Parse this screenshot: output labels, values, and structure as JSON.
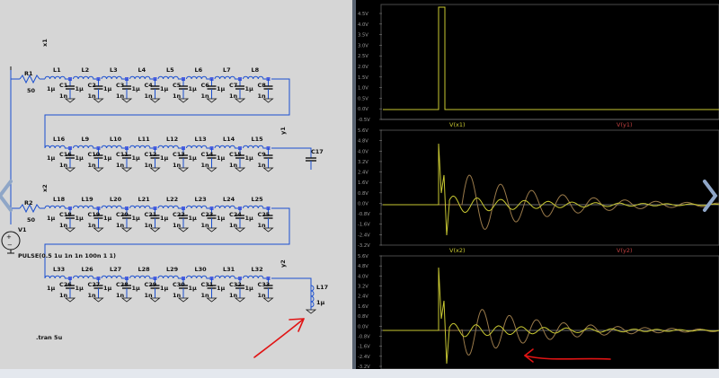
{
  "schematic": {
    "components": {
      "r1": "R1",
      "r1_val": "50",
      "r2": "R2",
      "r2_val": "50",
      "v1": "V1",
      "c17": "C17",
      "l17": "L17",
      "l17_val": "1µ"
    },
    "net_labels": {
      "x1": "x1",
      "y1": "y1",
      "x2": "x2",
      "y2": "y2"
    },
    "row1_inductors": [
      "L1",
      "L2",
      "L3",
      "L4",
      "L5",
      "L6",
      "L7",
      "L8"
    ],
    "row2_inductors": [
      "L16",
      "L9",
      "L10",
      "L11",
      "L12",
      "L13",
      "L14",
      "L15"
    ],
    "row3_inductors": [
      "L18",
      "L19",
      "L20",
      "L21",
      "L22",
      "L23",
      "L24",
      "L25"
    ],
    "row4_inductors": [
      "L33",
      "L26",
      "L27",
      "L28",
      "L29",
      "L30",
      "L31",
      "L32"
    ],
    "row1_caps": [
      "C1",
      "C2",
      "C3",
      "C4",
      "C5",
      "C6",
      "C7",
      "C8"
    ],
    "row2_caps": [
      "C16",
      "C10",
      "C11",
      "C12",
      "C13",
      "C14",
      "C15",
      "C9"
    ],
    "row3_caps": [
      "C18",
      "C19",
      "C20",
      "C21",
      "C22",
      "C23",
      "C24",
      "C25"
    ],
    "row4_caps": [
      "C26",
      "C27",
      "C28",
      "C29",
      "C30",
      "C31",
      "C32",
      "C33"
    ],
    "inductor_value": "1µ",
    "cap_value": "1n",
    "pulse_directive": "PULSE(0.5 1u 1n 1n 100n 1 1)",
    "tran_directive": ".tran 5u"
  },
  "waveforms": {
    "pane1": {
      "ticks": [
        "4.5V",
        "4.0V",
        "3.5V",
        "3.0V",
        "2.5V",
        "2.0V",
        "1.5V",
        "1.0V",
        "0.5V",
        "0.0V",
        "-0.5V"
      ]
    },
    "pane2": {
      "trace_a": "V(x1)",
      "trace_b": "V(y1)",
      "ticks": [
        "5.6V",
        "4.8V",
        "4.0V",
        "3.2V",
        "2.4V",
        "1.6V",
        "0.8V",
        "0.0V",
        "-0.8V",
        "-1.6V",
        "-2.4V",
        "-3.2V"
      ]
    },
    "pane3": {
      "trace_a": "V(x2)",
      "trace_b": "V(y2)",
      "ticks": [
        "5.6V",
        "4.8V",
        "4.0V",
        "3.2V",
        "2.4V",
        "1.6V",
        "0.8V",
        "0.0V",
        "-0.8V",
        "-1.6V",
        "-2.4V",
        "-3.2V"
      ]
    }
  },
  "colors": {
    "trace_a": "#c8c832",
    "trace_b": "#9a7a4a",
    "annotation": "#e11414",
    "selection": "#4a5fe0"
  }
}
